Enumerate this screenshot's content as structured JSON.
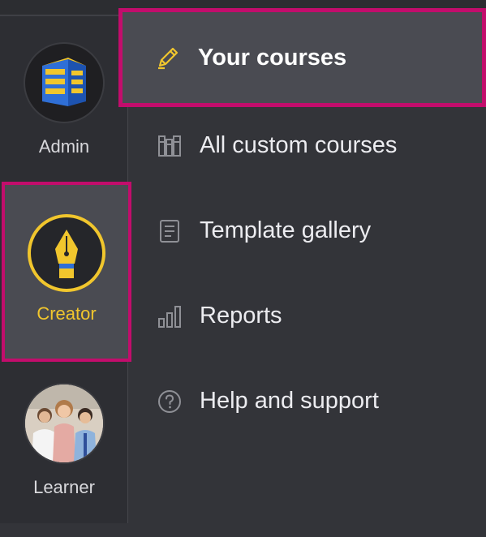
{
  "roles": [
    {
      "id": "admin",
      "label": "Admin",
      "icon": "building-icon",
      "selected": false
    },
    {
      "id": "creator",
      "label": "Creator",
      "icon": "pen-nib-icon",
      "selected": true
    },
    {
      "id": "learner",
      "label": "Learner",
      "icon": "group-photo",
      "selected": false
    }
  ],
  "menu": {
    "items": [
      {
        "label": "Your courses",
        "icon": "pencil-icon",
        "selected": true
      },
      {
        "label": "All custom courses",
        "icon": "library-icon",
        "selected": false
      },
      {
        "label": "Template gallery",
        "icon": "document-icon",
        "selected": false
      },
      {
        "label": "Reports",
        "icon": "bar-chart-icon",
        "selected": false
      },
      {
        "label": "Help and support",
        "icon": "help-icon",
        "selected": false
      }
    ]
  },
  "colors": {
    "highlight": "#c20d6c",
    "accent": "#f1c62d",
    "panel": "#333439",
    "rail": "#2d2e33",
    "selected_bg": "#4a4b52"
  }
}
